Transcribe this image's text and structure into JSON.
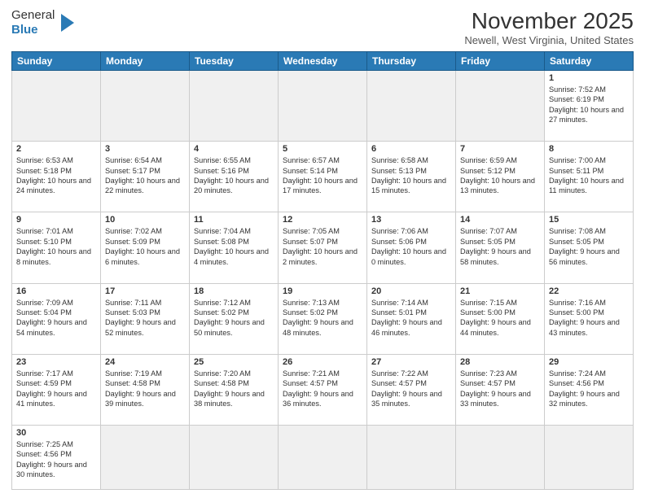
{
  "header": {
    "logo_text_general": "General",
    "logo_text_blue": "Blue",
    "month_title": "November 2025",
    "location": "Newell, West Virginia, United States"
  },
  "weekdays": [
    "Sunday",
    "Monday",
    "Tuesday",
    "Wednesday",
    "Thursday",
    "Friday",
    "Saturday"
  ],
  "weeks": [
    [
      {
        "day": "",
        "info": ""
      },
      {
        "day": "",
        "info": ""
      },
      {
        "day": "",
        "info": ""
      },
      {
        "day": "",
        "info": ""
      },
      {
        "day": "",
        "info": ""
      },
      {
        "day": "",
        "info": ""
      },
      {
        "day": "1",
        "info": "Sunrise: 7:52 AM\nSunset: 6:19 PM\nDaylight: 10 hours\nand 27 minutes."
      }
    ],
    [
      {
        "day": "2",
        "info": "Sunrise: 6:53 AM\nSunset: 5:18 PM\nDaylight: 10 hours\nand 24 minutes."
      },
      {
        "day": "3",
        "info": "Sunrise: 6:54 AM\nSunset: 5:17 PM\nDaylight: 10 hours\nand 22 minutes."
      },
      {
        "day": "4",
        "info": "Sunrise: 6:55 AM\nSunset: 5:16 PM\nDaylight: 10 hours\nand 20 minutes."
      },
      {
        "day": "5",
        "info": "Sunrise: 6:57 AM\nSunset: 5:14 PM\nDaylight: 10 hours\nand 17 minutes."
      },
      {
        "day": "6",
        "info": "Sunrise: 6:58 AM\nSunset: 5:13 PM\nDaylight: 10 hours\nand 15 minutes."
      },
      {
        "day": "7",
        "info": "Sunrise: 6:59 AM\nSunset: 5:12 PM\nDaylight: 10 hours\nand 13 minutes."
      },
      {
        "day": "8",
        "info": "Sunrise: 7:00 AM\nSunset: 5:11 PM\nDaylight: 10 hours\nand 11 minutes."
      }
    ],
    [
      {
        "day": "9",
        "info": "Sunrise: 7:01 AM\nSunset: 5:10 PM\nDaylight: 10 hours\nand 8 minutes."
      },
      {
        "day": "10",
        "info": "Sunrise: 7:02 AM\nSunset: 5:09 PM\nDaylight: 10 hours\nand 6 minutes."
      },
      {
        "day": "11",
        "info": "Sunrise: 7:04 AM\nSunset: 5:08 PM\nDaylight: 10 hours\nand 4 minutes."
      },
      {
        "day": "12",
        "info": "Sunrise: 7:05 AM\nSunset: 5:07 PM\nDaylight: 10 hours\nand 2 minutes."
      },
      {
        "day": "13",
        "info": "Sunrise: 7:06 AM\nSunset: 5:06 PM\nDaylight: 10 hours\nand 0 minutes."
      },
      {
        "day": "14",
        "info": "Sunrise: 7:07 AM\nSunset: 5:05 PM\nDaylight: 9 hours\nand 58 minutes."
      },
      {
        "day": "15",
        "info": "Sunrise: 7:08 AM\nSunset: 5:05 PM\nDaylight: 9 hours\nand 56 minutes."
      }
    ],
    [
      {
        "day": "16",
        "info": "Sunrise: 7:09 AM\nSunset: 5:04 PM\nDaylight: 9 hours\nand 54 minutes."
      },
      {
        "day": "17",
        "info": "Sunrise: 7:11 AM\nSunset: 5:03 PM\nDaylight: 9 hours\nand 52 minutes."
      },
      {
        "day": "18",
        "info": "Sunrise: 7:12 AM\nSunset: 5:02 PM\nDaylight: 9 hours\nand 50 minutes."
      },
      {
        "day": "19",
        "info": "Sunrise: 7:13 AM\nSunset: 5:02 PM\nDaylight: 9 hours\nand 48 minutes."
      },
      {
        "day": "20",
        "info": "Sunrise: 7:14 AM\nSunset: 5:01 PM\nDaylight: 9 hours\nand 46 minutes."
      },
      {
        "day": "21",
        "info": "Sunrise: 7:15 AM\nSunset: 5:00 PM\nDaylight: 9 hours\nand 44 minutes."
      },
      {
        "day": "22",
        "info": "Sunrise: 7:16 AM\nSunset: 5:00 PM\nDaylight: 9 hours\nand 43 minutes."
      }
    ],
    [
      {
        "day": "23",
        "info": "Sunrise: 7:17 AM\nSunset: 4:59 PM\nDaylight: 9 hours\nand 41 minutes."
      },
      {
        "day": "24",
        "info": "Sunrise: 7:19 AM\nSunset: 4:58 PM\nDaylight: 9 hours\nand 39 minutes."
      },
      {
        "day": "25",
        "info": "Sunrise: 7:20 AM\nSunset: 4:58 PM\nDaylight: 9 hours\nand 38 minutes."
      },
      {
        "day": "26",
        "info": "Sunrise: 7:21 AM\nSunset: 4:57 PM\nDaylight: 9 hours\nand 36 minutes."
      },
      {
        "day": "27",
        "info": "Sunrise: 7:22 AM\nSunset: 4:57 PM\nDaylight: 9 hours\nand 35 minutes."
      },
      {
        "day": "28",
        "info": "Sunrise: 7:23 AM\nSunset: 4:57 PM\nDaylight: 9 hours\nand 33 minutes."
      },
      {
        "day": "29",
        "info": "Sunrise: 7:24 AM\nSunset: 4:56 PM\nDaylight: 9 hours\nand 32 minutes."
      }
    ],
    [
      {
        "day": "30",
        "info": "Sunrise: 7:25 AM\nSunset: 4:56 PM\nDaylight: 9 hours\nand 30 minutes."
      },
      {
        "day": "",
        "info": ""
      },
      {
        "day": "",
        "info": ""
      },
      {
        "day": "",
        "info": ""
      },
      {
        "day": "",
        "info": ""
      },
      {
        "day": "",
        "info": ""
      },
      {
        "day": "",
        "info": ""
      }
    ]
  ]
}
